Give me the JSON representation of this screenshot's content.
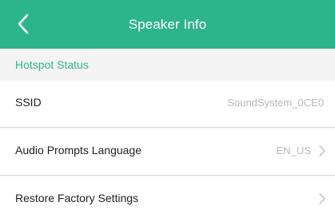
{
  "header": {
    "title": "Speaker Info",
    "back_icon": "chevron-left-icon",
    "background": "#2db58a"
  },
  "section": {
    "title": "Hotspot Status",
    "accent": "#2db58a"
  },
  "rows": [
    {
      "label": "SSID",
      "value": "SoundSystem_0CE0"
    },
    {
      "label": "Audio Prompts Language",
      "value": "EN_US",
      "icon": "chevron-right-icon"
    },
    {
      "label": "Restore Factory Settings",
      "value": "",
      "icon": "chevron-right-icon"
    }
  ]
}
